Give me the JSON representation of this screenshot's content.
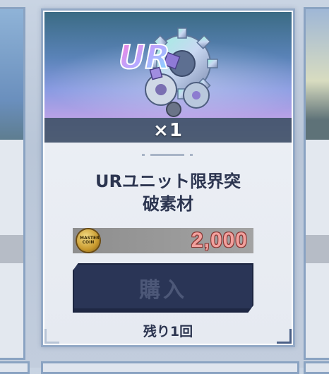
{
  "item": {
    "rarity_badge": "UR",
    "quantity": "×1",
    "name": "URユニット限界突\n破素材",
    "price": "2,000",
    "currency_icon": "master-coin-icon",
    "currency_label": "MASTER COIN",
    "buy_label": "購入",
    "remaining": "残り1回"
  },
  "colors": {
    "card_border": "#93a9c6",
    "button_bg": "#2a3556",
    "price_text": "#f2a09d",
    "name_text": "#2c3550"
  }
}
